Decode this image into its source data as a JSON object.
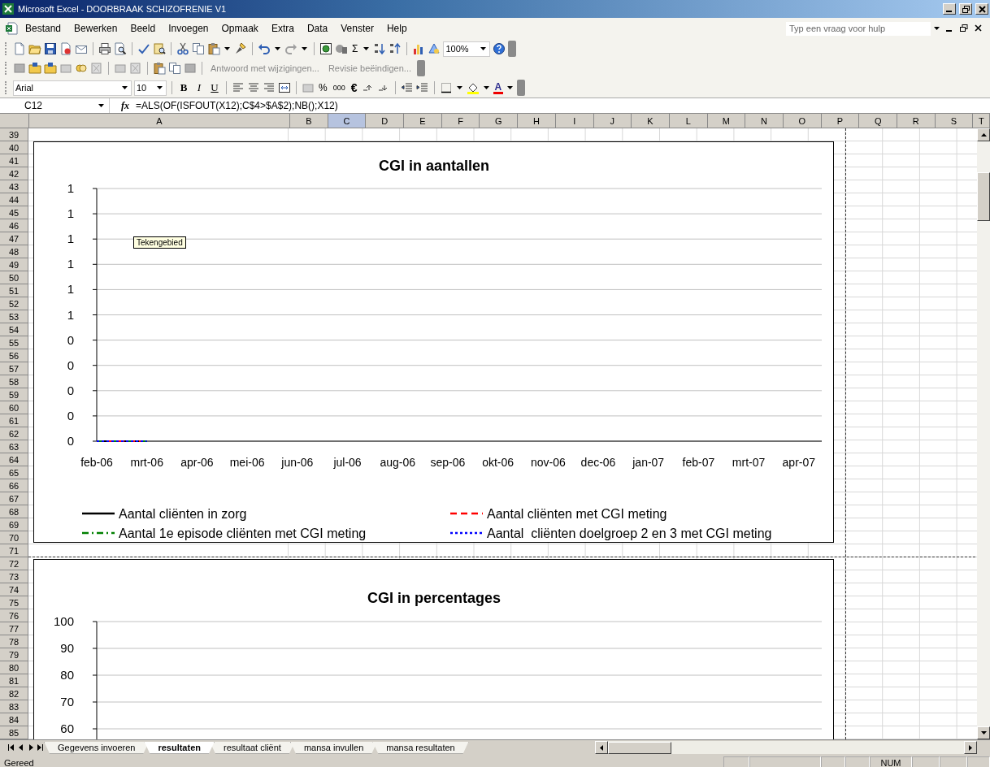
{
  "window": {
    "title": "Microsoft Excel - DOORBRAAK SCHIZOFRENIE V1"
  },
  "menu": {
    "items": [
      "Bestand",
      "Bewerken",
      "Beeld",
      "Invoegen",
      "Opmaak",
      "Extra",
      "Data",
      "Venster",
      "Help"
    ],
    "help_placeholder": "Typ een vraag voor hulp"
  },
  "standard_toolbar": {
    "sum": "Σ",
    "zoom": "100%"
  },
  "reviewing_toolbar": {
    "buttons": [
      {
        "label": "Antwoord met wijzigingen...",
        "disabled": true
      },
      {
        "label": "Revisie beëindigen...",
        "disabled": true
      }
    ]
  },
  "formatting_toolbar": {
    "font": "Arial",
    "size": "10",
    "bold": "B",
    "italic": "I",
    "underline": "U",
    "percent": "%",
    "thousands": "000",
    "euro": "€",
    "font_color": "A"
  },
  "formula_bar": {
    "name_box": "C12",
    "fx": "fx",
    "formula": "=ALS(OF(ISFOUT(X12);C$4>$A$2);NB();X12)"
  },
  "columns": [
    {
      "label": "A",
      "selected": false
    },
    {
      "label": "B",
      "selected": false
    },
    {
      "label": "C",
      "selected": true
    },
    {
      "label": "D",
      "selected": false
    },
    {
      "label": "E",
      "selected": false
    },
    {
      "label": "F",
      "selected": false
    },
    {
      "label": "G",
      "selected": false
    },
    {
      "label": "H",
      "selected": false
    },
    {
      "label": "I",
      "selected": false
    },
    {
      "label": "J",
      "selected": false
    },
    {
      "label": "K",
      "selected": false
    },
    {
      "label": "L",
      "selected": false
    },
    {
      "label": "M",
      "selected": false
    },
    {
      "label": "N",
      "selected": false
    },
    {
      "label": "O",
      "selected": false
    },
    {
      "label": "P",
      "selected": false
    },
    {
      "label": "Q",
      "selected": false
    },
    {
      "label": "R",
      "selected": false
    },
    {
      "label": "S",
      "selected": false
    },
    {
      "label": "T",
      "selected": false
    }
  ],
  "rows": [
    "39",
    "40",
    "41",
    "42",
    "43",
    "44",
    "45",
    "46",
    "47",
    "48",
    "49",
    "50",
    "51",
    "52",
    "53",
    "54",
    "55",
    "56",
    "57",
    "58",
    "59",
    "60",
    "61",
    "62",
    "63",
    "64",
    "65",
    "66",
    "67",
    "68",
    "69",
    "70",
    "71",
    "72",
    "73",
    "74",
    "75",
    "76",
    "77",
    "78",
    "79",
    "80",
    "81",
    "82",
    "83",
    "84",
    "85"
  ],
  "charts": [
    {
      "tooltip": "Tekengebied",
      "chart_data": {
        "type": "line",
        "title": "CGI in aantallen",
        "grid": true,
        "legend": true,
        "categories": [
          "feb-06",
          "mrt-06",
          "apr-06",
          "mei-06",
          "jun-06",
          "jul-06",
          "aug-06",
          "sep-06",
          "okt-06",
          "nov-06",
          "dec-06",
          "jan-07",
          "feb-07",
          "mrt-07",
          "apr-07"
        ],
        "ylim": [
          0,
          1
        ],
        "yticks": [
          {
            "value": 1,
            "label": "1"
          },
          {
            "value": 0.9,
            "label": "1"
          },
          {
            "value": 0.8,
            "label": "1"
          },
          {
            "value": 0.7,
            "label": "1"
          },
          {
            "value": 0.6,
            "label": "1"
          },
          {
            "value": 0.5,
            "label": "1"
          },
          {
            "value": 0.4,
            "label": "0"
          },
          {
            "value": 0.3,
            "label": "0"
          },
          {
            "value": 0.2,
            "label": "0"
          },
          {
            "value": 0.1,
            "label": "0"
          },
          {
            "value": 0,
            "label": "0"
          }
        ],
        "series": [
          {
            "name": "Aantal cliënten in zorg",
            "color": "#000000",
            "line_style": "solid",
            "values": [
              0,
              0,
              null,
              null,
              null,
              null,
              null,
              null,
              null,
              null,
              null,
              null,
              null,
              null,
              null
            ]
          },
          {
            "name": "Aantal cliënten met CGI meting",
            "color": "#ff0000",
            "line_style": "dash",
            "values": [
              0,
              0,
              null,
              null,
              null,
              null,
              null,
              null,
              null,
              null,
              null,
              null,
              null,
              null,
              null
            ]
          },
          {
            "name": "Aantal 1e episode cliënten met CGI meting",
            "color": "#008000",
            "line_style": "dashdot",
            "values": [
              0,
              0,
              null,
              null,
              null,
              null,
              null,
              null,
              null,
              null,
              null,
              null,
              null,
              null,
              null
            ]
          },
          {
            "name": "Aantal  cliënten doelgroep 2 en 3 met CGI meting",
            "color": "#0000ff",
            "line_style": "dot",
            "values": [
              0,
              0,
              null,
              null,
              null,
              null,
              null,
              null,
              null,
              null,
              null,
              null,
              null,
              null,
              null
            ]
          }
        ]
      }
    },
    {
      "chart_data": {
        "type": "line",
        "title": "CGI in percentages",
        "grid": true,
        "categories": [
          null,
          null,
          null,
          null,
          null,
          null,
          null,
          null,
          null,
          null,
          null,
          null,
          null,
          null,
          null
        ],
        "ylim": [
          0,
          100
        ],
        "yticks": [
          100,
          90,
          80,
          70,
          60
        ]
      }
    }
  ],
  "sheet_tabs": [
    {
      "label": "Gegevens invoeren",
      "selected": false
    },
    {
      "label": "resultaten",
      "selected": true
    },
    {
      "label": "resultaat cliënt",
      "selected": false
    },
    {
      "label": "mansa invullen",
      "selected": false
    },
    {
      "label": "mansa resultaten",
      "selected": false
    }
  ],
  "status_bar": {
    "text": "Gereed",
    "indicator": "NUM"
  }
}
